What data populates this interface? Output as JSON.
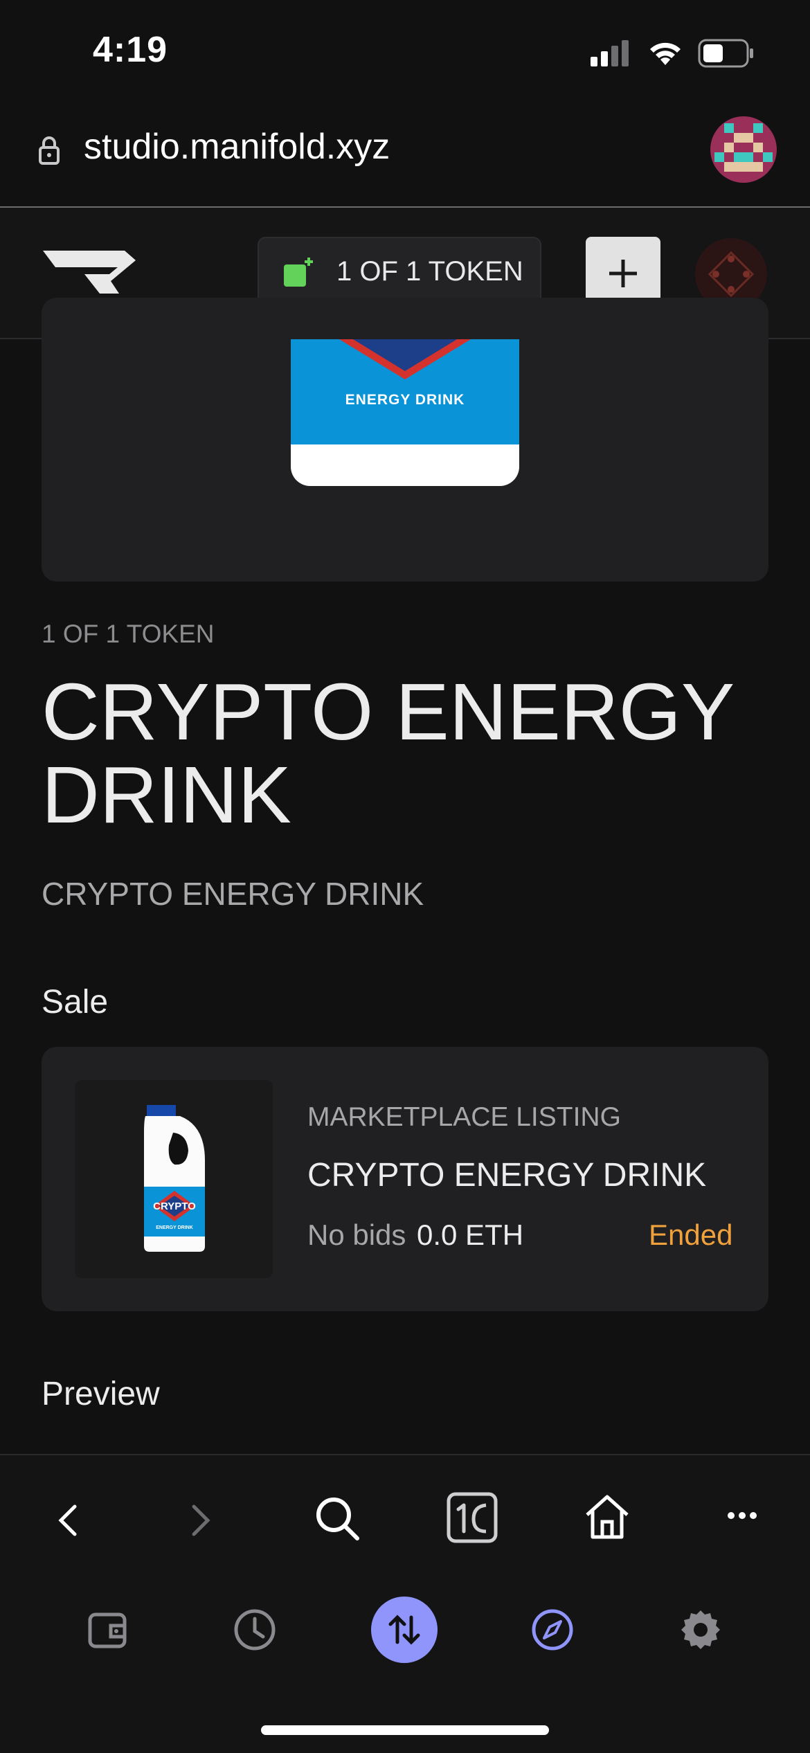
{
  "status_bar": {
    "time": "4:19"
  },
  "url_bar": {
    "url": "studio.manifold.xyz"
  },
  "app_header": {
    "token_pill_label": "1 OF 1 TOKEN",
    "plus_label": "+"
  },
  "artwork": {
    "label": "ENERGY DRINK"
  },
  "token": {
    "type_label": "1 OF 1 TOKEN",
    "title": "CRYPTO ENERGY DRINK",
    "subtitle": "CRYPTO ENERGY DRINK"
  },
  "sale": {
    "heading": "Sale",
    "listing_type": "MARKETPLACE LISTING",
    "listing_title": "CRYPTO ENERGY DRINK",
    "bids": "No bids",
    "price": "0.0 ETH",
    "status": "Ended",
    "thumb_brand": "CRYPTO",
    "thumb_caption": "ENERGY DRINK"
  },
  "preview": {
    "heading": "Preview"
  },
  "colors": {
    "accent": "#8f95fb",
    "ended": "#f0a13c",
    "pill_green": "#62d25a"
  }
}
